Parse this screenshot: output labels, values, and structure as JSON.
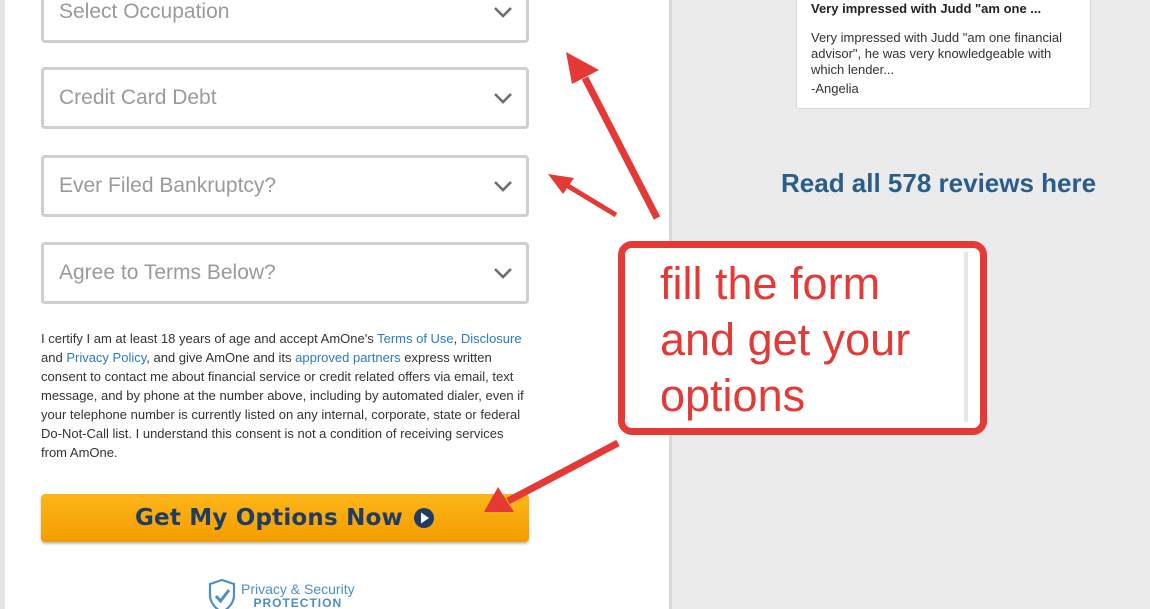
{
  "form": {
    "fields": [
      {
        "placeholder": "Select Occupation"
      },
      {
        "placeholder": "Credit Card Debt"
      },
      {
        "placeholder": "Ever Filed Bankruptcy?"
      },
      {
        "placeholder": "Agree to Terms Below?"
      }
    ],
    "consent": {
      "t1": "I certify I am at least 18 years of age and accept AmOne's ",
      "terms_link": "Terms of Use",
      "t2": ", ",
      "disclosure_link": "Disclosure",
      "t3": " and ",
      "privacy_link": "Privacy Policy",
      "t4": ", and give AmOne and its ",
      "partners_link": "approved partners",
      "t5": " express written consent to contact me about financial service or credit related offers via email, text message, and by phone at the number above, including by automated dialer, even if your telephone number is currently listed on any internal, corporate, state or federal Do-Not-Call list. I understand this consent is not a condition of receiving services from AmOne."
    },
    "cta_label": "Get My Options Now",
    "privacy_badge": {
      "line1": "Privacy & Security",
      "line2": "PROTECTION"
    }
  },
  "review": {
    "title": "Very impressed with Judd \"am one ...",
    "body": "Very impressed with Judd \"am one financial advisor\", he was very knowledgeable with which lender...",
    "author": "-Angelia"
  },
  "reviews_link": "Read all 578 reviews here",
  "annotation": {
    "lines": [
      "fill the form",
      "and get your",
      "options"
    ]
  },
  "colors": {
    "annotation_red": "#e53935",
    "cta_orange": "#f7a40a",
    "link_blue": "#2a7bbf",
    "heading_blue": "#2a5d8a"
  }
}
